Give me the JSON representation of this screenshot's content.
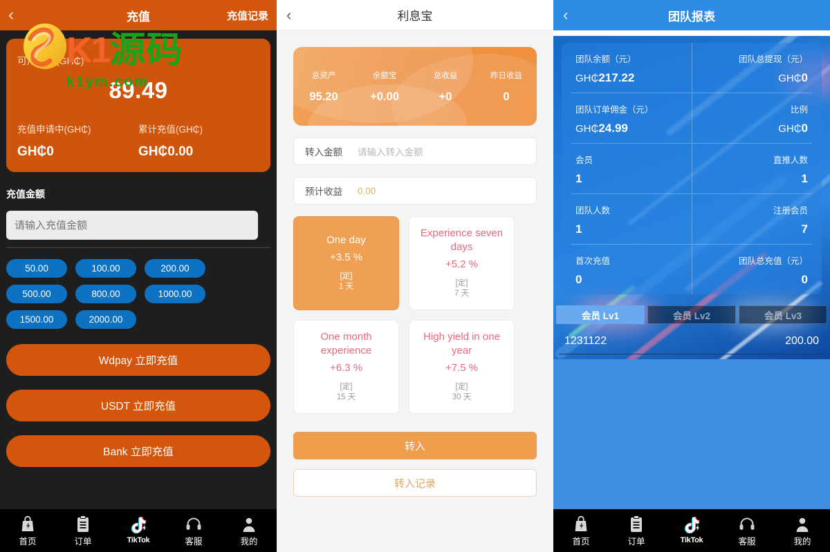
{
  "watermark": {
    "brand_left": "K1",
    "brand_right": "源码",
    "domain": "k1ym.com"
  },
  "tabbar": {
    "items": [
      {
        "label": "首页",
        "icon": "bag-icon"
      },
      {
        "label": "订单",
        "icon": "clipboard-icon"
      },
      {
        "label": "TikTok",
        "icon": "tiktok-icon"
      },
      {
        "label": "客服",
        "icon": "headset-icon"
      },
      {
        "label": "我的",
        "icon": "person-icon"
      }
    ]
  },
  "recharge": {
    "header": {
      "back": "‹",
      "title": "充值",
      "records": "充值记录"
    },
    "balance_card": {
      "available_label": "可用余额(GH₵)",
      "available_value": "89.49",
      "pending_label": "充值申请中(GH₵)",
      "pending_value": "GH₵0",
      "total_label": "累计充值(GH₵)",
      "total_value": "GH₵0.00"
    },
    "section_title": "充值金额",
    "amount_input": {
      "value": "",
      "placeholder": "请输入充值金额"
    },
    "quick_amounts": [
      "50.00",
      "100.00",
      "200.00",
      "500.00",
      "800.00",
      "1000.00",
      "1500.00",
      "2000.00"
    ],
    "pay_buttons": [
      "Wdpay 立即充值",
      "USDT 立即充值",
      "Bank 立即充值"
    ],
    "colors": {
      "header": "#d4560c",
      "card": "#cf540c",
      "chip": "#0e72c4",
      "background": "#1e1e1e"
    }
  },
  "lixibao": {
    "header": {
      "back": "‹",
      "title": "利息宝"
    },
    "hero": {
      "cells": [
        {
          "label": "总资产",
          "value": "95.20"
        },
        {
          "label": "余额宝",
          "value": "+0.00"
        },
        {
          "label": "总收益",
          "value": "+0"
        },
        {
          "label": "昨日收益",
          "value": "0"
        }
      ]
    },
    "fields": [
      {
        "label": "转入金额",
        "value": "",
        "placeholder": "请输入转入金额",
        "amber": false
      },
      {
        "label": "预计收益",
        "value": "0.00",
        "placeholder": "",
        "amber": true
      }
    ],
    "products": [
      {
        "name": "One day",
        "rate": "+3.5 %",
        "tag": "[定]",
        "term": "1 天",
        "active": true
      },
      {
        "name": "Experience seven days",
        "rate": "+5.2 %",
        "tag": "[定]",
        "term": "7 天",
        "active": false
      },
      {
        "name": "One month experience",
        "rate": "+6.3 %",
        "tag": "[定]",
        "term": "15 天",
        "active": false
      },
      {
        "name": "High yield in one year",
        "rate": "+7.5 %",
        "tag": "[定]",
        "term": "30 天",
        "active": false
      }
    ],
    "primary_button": "转入",
    "ghost_button": "转入记录",
    "colors": {
      "accent": "#ef9e4e",
      "product_text": "#e8697c",
      "background": "#f4f4f4"
    }
  },
  "team": {
    "header": {
      "back": "‹",
      "title": "团队报表"
    },
    "stats": [
      {
        "label": "团队余额（元）",
        "currency": "GH₵",
        "value": "217.22"
      },
      {
        "label": "团队总提现（元）",
        "currency": "GH₵",
        "value": "0"
      },
      {
        "label": "团队订单佣金（元）",
        "currency": "GH₵",
        "value": "24.99"
      },
      {
        "label": "比例",
        "currency": "GH₵",
        "value": "0"
      },
      {
        "label": "会员",
        "currency": "",
        "value": "1"
      },
      {
        "label": "直推人数",
        "currency": "",
        "value": "1"
      },
      {
        "label": "团队人数",
        "currency": "",
        "value": "1"
      },
      {
        "label": "注册会员",
        "currency": "",
        "value": "7"
      },
      {
        "label": "首次充值",
        "currency": "",
        "value": "0"
      },
      {
        "label": "团队总充值（元）",
        "currency": "",
        "value": "0"
      }
    ],
    "tabs": [
      {
        "label": "会员 Lv1",
        "active": true
      },
      {
        "label": "会员 Lv2",
        "active": false
      },
      {
        "label": "会员 Lv3",
        "active": false
      }
    ],
    "list": [
      {
        "name": "1231122",
        "amount": "200.00"
      }
    ],
    "colors": {
      "header": "#2d8be4",
      "tab_active": "#68a9f0",
      "content": "#3d8ee0"
    }
  }
}
